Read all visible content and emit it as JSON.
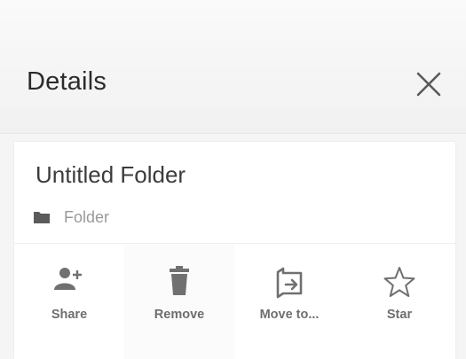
{
  "header": {
    "title": "Details",
    "close_icon": "close-icon"
  },
  "item": {
    "name": "Untitled Folder",
    "type_label": "Folder",
    "type_icon": "folder-icon"
  },
  "actions": [
    {
      "label": "Share",
      "icon": "add-person-icon"
    },
    {
      "label": "Remove",
      "icon": "trash-icon"
    },
    {
      "label": "Move to...",
      "icon": "move-folder-icon"
    },
    {
      "label": "Star",
      "icon": "star-outline-icon"
    }
  ],
  "colors": {
    "header_bg": "#f3f3f3",
    "text_dark": "#2b2b2b",
    "text_muted": "#9a9a9a",
    "icon_gray": "#707070"
  }
}
